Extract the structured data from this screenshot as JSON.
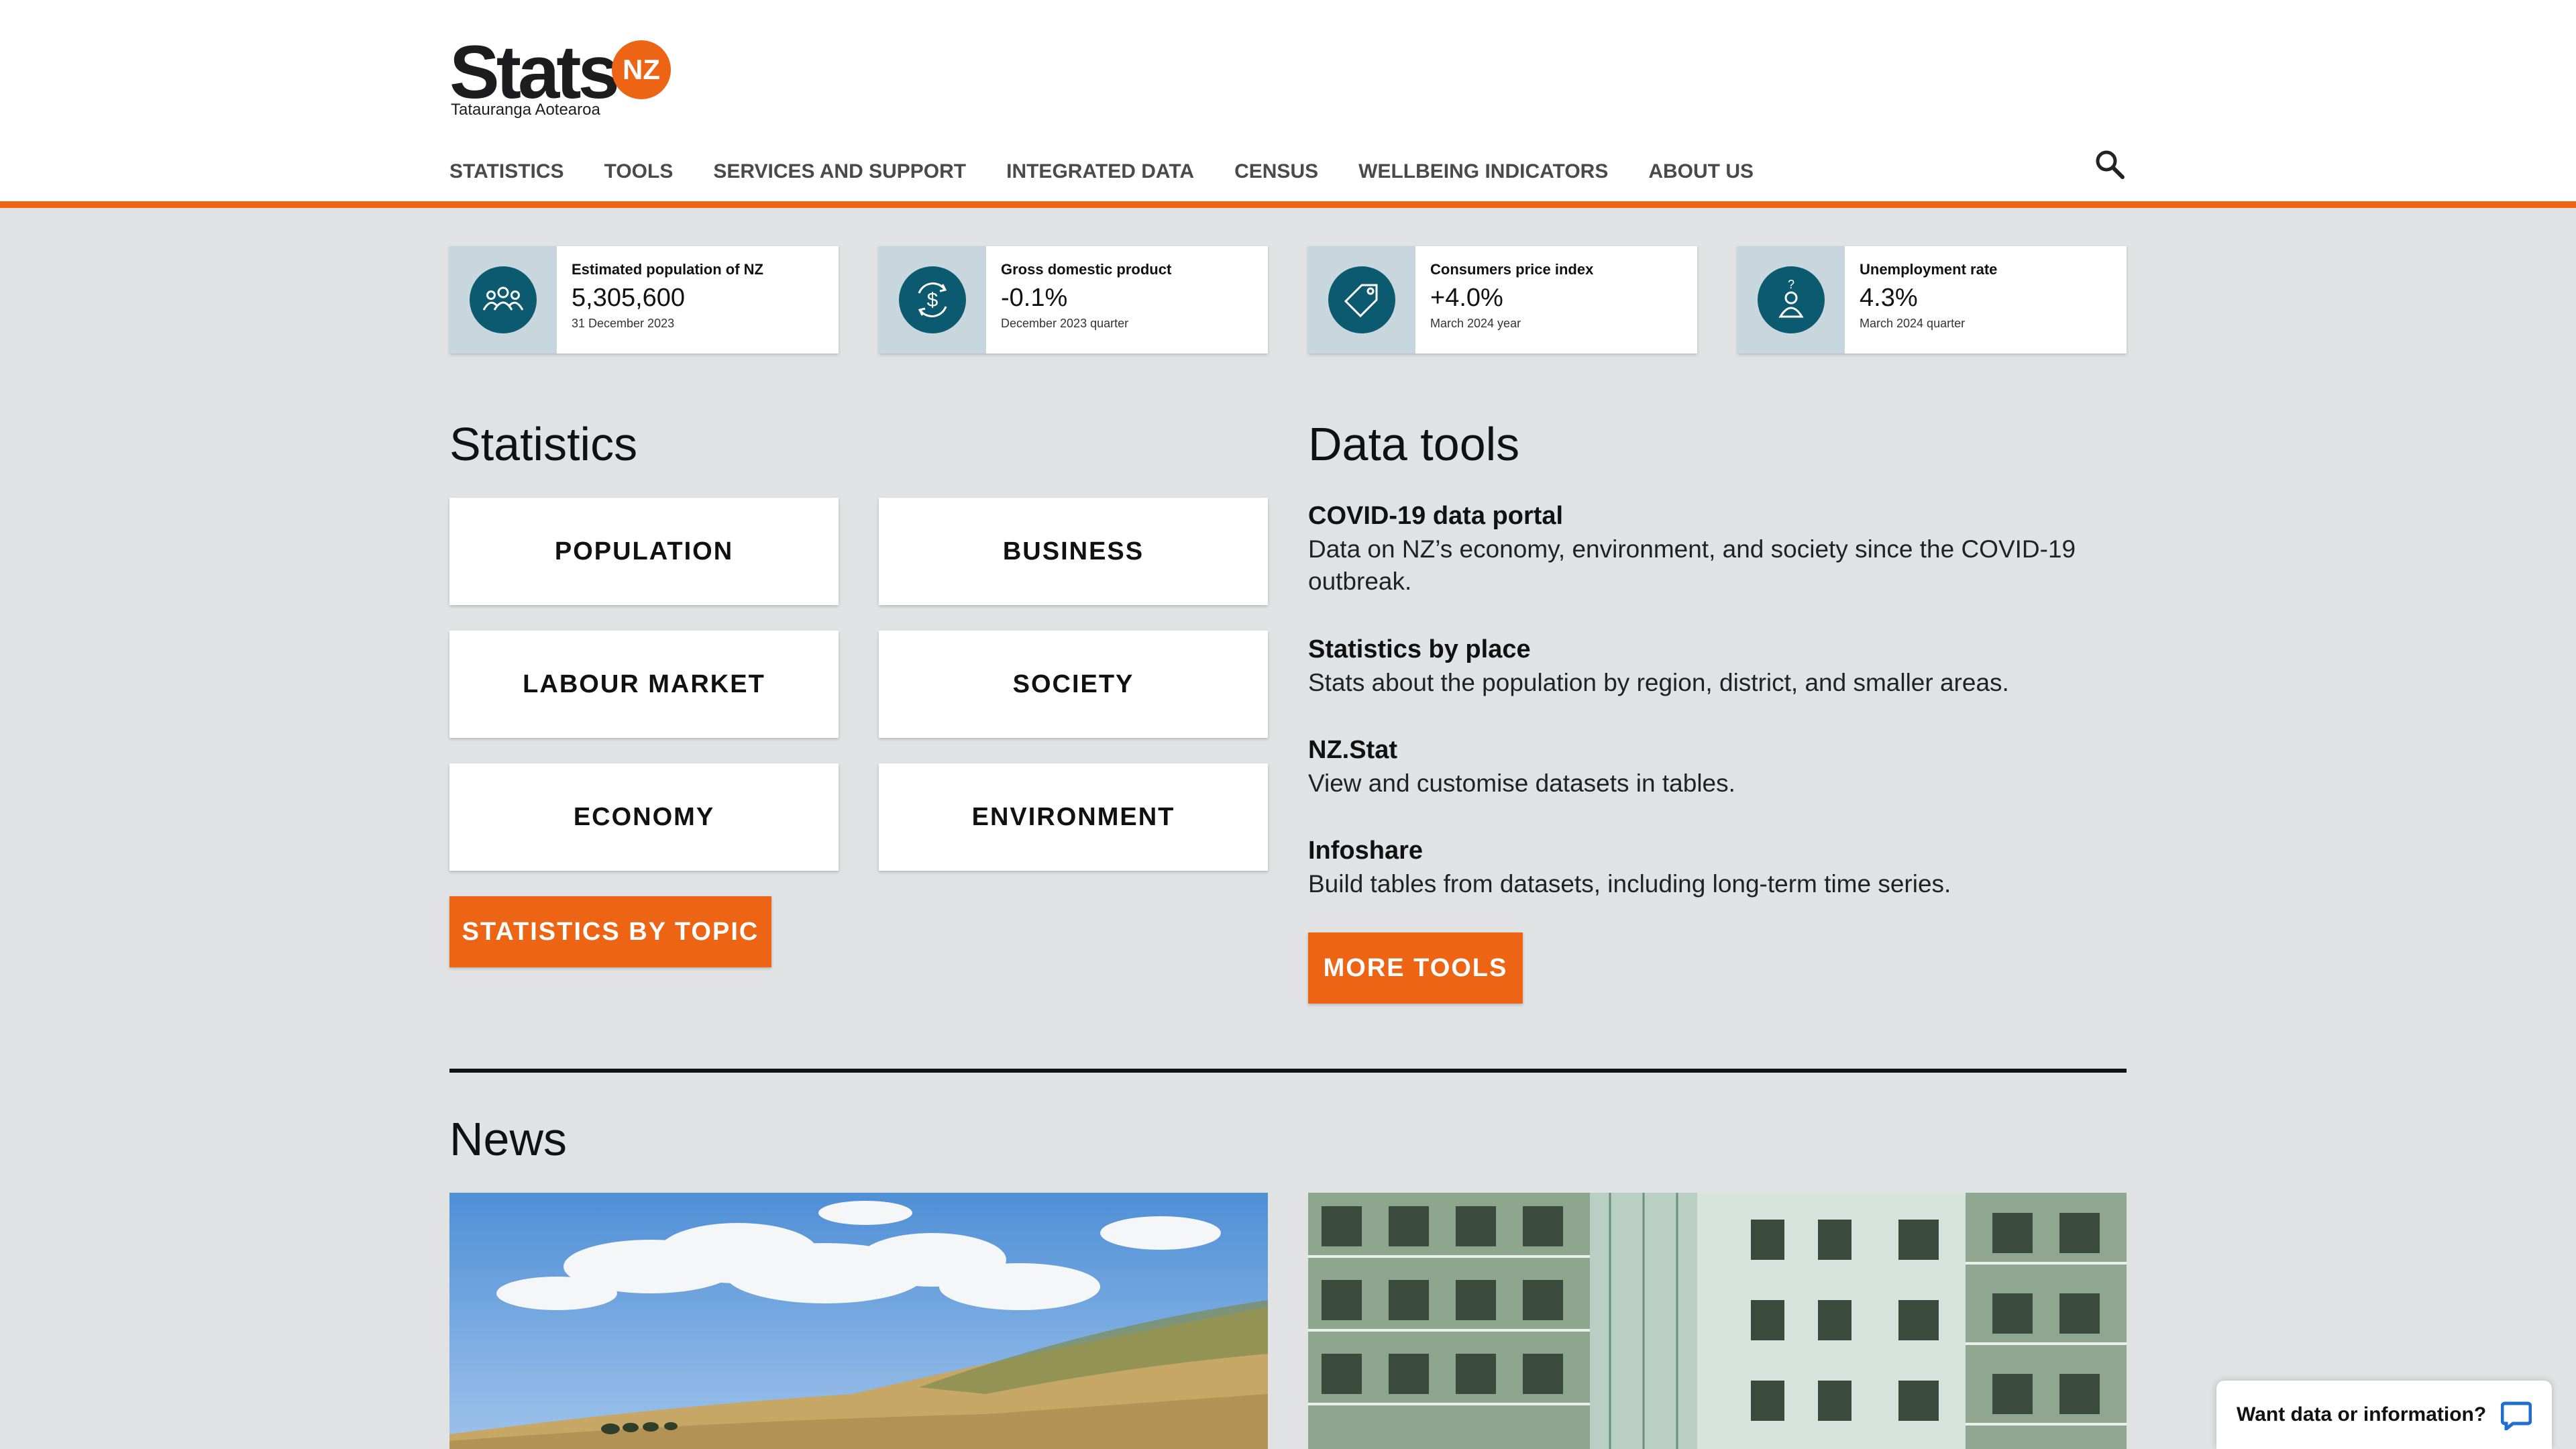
{
  "logo": {
    "wordmark": "Stats",
    "badge": "NZ",
    "tagline": "Tatauranga Aotearoa"
  },
  "nav": {
    "items": [
      {
        "label": "STATISTICS"
      },
      {
        "label": "TOOLS"
      },
      {
        "label": "SERVICES AND SUPPORT"
      },
      {
        "label": "INTEGRATED DATA"
      },
      {
        "label": "CENSUS"
      },
      {
        "label": "WELLBEING INDICATORS"
      },
      {
        "label": "ABOUT US"
      }
    ],
    "search_icon": "search-icon"
  },
  "kpis": [
    {
      "label": "Estimated population of NZ",
      "value": "5,305,600",
      "date": "31 December 2023",
      "icon": "people-icon"
    },
    {
      "label": "Gross domestic product",
      "value": "-0.1%",
      "date": "December 2023 quarter",
      "icon": "dollar-cycle-icon"
    },
    {
      "label": "Consumers price index",
      "value": "+4.0%",
      "date": "March 2024 year",
      "icon": "price-tag-icon"
    },
    {
      "label": "Unemployment rate",
      "value": "4.3%",
      "date": "March 2024 quarter",
      "icon": "person-question-icon"
    }
  ],
  "statistics": {
    "title": "Statistics",
    "tiles": [
      "POPULATION",
      "BUSINESS",
      "LABOUR MARKET",
      "SOCIETY",
      "ECONOMY",
      "ENVIRONMENT"
    ],
    "button": "STATISTICS BY TOPIC"
  },
  "data_tools": {
    "title": "Data tools",
    "items": [
      {
        "title": "COVID-19 data portal",
        "desc": "Data on NZ’s economy, environment, and society since the COVID-19 outbreak."
      },
      {
        "title": "Statistics by place",
        "desc": "Stats about the population by region, district, and smaller areas."
      },
      {
        "title": "NZ.Stat",
        "desc": "View and customise datasets in tables."
      },
      {
        "title": "Infoshare",
        "desc": "Build tables from datasets, including long-term time series."
      }
    ],
    "button": "MORE TOOLS"
  },
  "news": {
    "title": "News"
  },
  "chat": {
    "label": "Want data or information?",
    "icon": "chat-bubble-icon"
  },
  "colors": {
    "accent": "#ec6414",
    "icon_teal": "#0b5a70",
    "page_bg": "#e1e2e4"
  }
}
